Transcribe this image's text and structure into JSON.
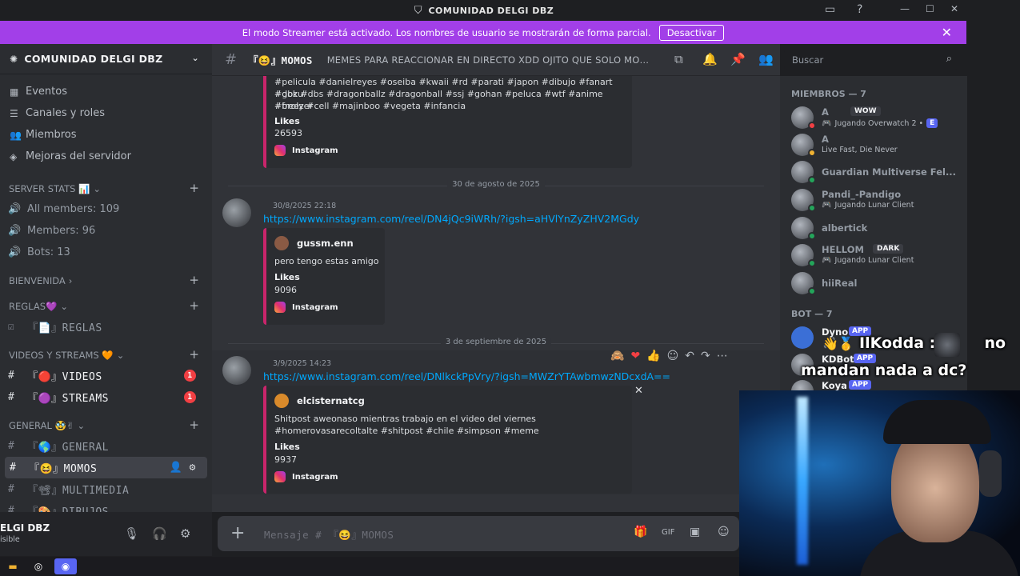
{
  "titlebar": {
    "title": "COMUNIDAD DELGI DBZ"
  },
  "banner": {
    "message": "El modo Streamer está activado. Los nombres de usuario se mostrarán de forma parcial.",
    "button": "Desactivar"
  },
  "server": {
    "name": "COMUNIDAD DELGI DBZ",
    "menu": [
      "Eventos",
      "Canales y roles",
      "Miembros",
      "Mejoras del servidor"
    ],
    "categories": {
      "stats": "SERVER STATS 📊",
      "bienvenida": "BIENVENIDA",
      "reglas": "REGLAS💜",
      "videos": "VIDEOS Y STREAMS 🧡",
      "general": "GENERAL 🥸✌"
    },
    "stats_channels": [
      "All members: 109",
      "Members: 96",
      "Bots: 13"
    ],
    "channels": {
      "reglas": "『📄』REGLAS",
      "videos": "『🔴』VIDEOS",
      "streams": "『🟣』STREAMS",
      "general": "『🌎』GENERAL",
      "momos": "『😆』MOMOS",
      "multimedia": "『📽』MULTIMEDIA",
      "dibujos": "『🎨』DIBUJOS"
    },
    "badges": {
      "videos": "1",
      "streams": "1"
    }
  },
  "user": {
    "name": "ELGI DBZ",
    "status": "isible"
  },
  "channel_header": {
    "name": "『😆』MOMOS",
    "topic": "MEMES PARA REACCIONAR EN DIRECTO XDD OJITO QUE SOLO MOMAZOS"
  },
  "search": {
    "placeholder": "Buscar"
  },
  "messages": {
    "m1": {
      "text_lines": [
        "#pelicula #danielreyes #oseiba #kwaii #rd #parati #japon #dibujo #fanart #goku",
        "#dbz #dbs #dragonballz #dragonball #ssj #gohan #peluca #wtf #anime #freezer",
        "#broly #cell #majinboo #vegeta #infancia"
      ],
      "likes_label": "Likes",
      "likes": "26593",
      "provider": "Instagram"
    },
    "date2": "30 de agosto de 2025",
    "m2": {
      "timestamp": "30/8/2025 22:18",
      "link": "https://www.instagram.com/reel/DN4jQc9iWRh/?igsh=aHVlYnZyZHV2MGdy",
      "author": "gussm.enn",
      "text": "pero tengo estas amigo",
      "likes_label": "Likes",
      "likes": "9096",
      "provider": "Instagram"
    },
    "date3": "3 de septiembre de 2025",
    "m3": {
      "timestamp": "3/9/2025 14:23",
      "link": "https://www.instagram.com/reel/DNlkckPpVry/?igsh=MWZrYTAwbmwzNDcxdA==",
      "author": "elcisternatcg",
      "text_lines": [
        "Shitpost aweonaso mientras trabajo en el video del viernes",
        "#homerovasarecoltalte #shitpost #chile #simpson #meme"
      ],
      "likes_label": "Likes",
      "likes": "9937",
      "provider": "Instagram"
    }
  },
  "composer": {
    "placeholder": "Mensaje # 『😆』MOMOS"
  },
  "members": {
    "header": "MIEMBROS — 7",
    "list": [
      {
        "name": "A",
        "tag": "WOW",
        "activity": "Jugando Overwatch 2 •"
      },
      {
        "name": "A",
        "tag": "",
        "activity": "Live Fast, Die Never"
      },
      {
        "name": "Guardian Multiverse Fel...",
        "tag": "",
        "activity": ""
      },
      {
        "name": "Pandi_-Pandigo",
        "tag": "",
        "activity": "Jugando Lunar Client"
      },
      {
        "name": "albertick",
        "tag": "",
        "activity": ""
      },
      {
        "name": "HELLOM",
        "tag": "DARK",
        "activity": "Jugando Lunar Client"
      },
      {
        "name": "hiiReal",
        "tag": "",
        "activity": ""
      }
    ],
    "bot_header": "BOT — 7",
    "bots": [
      {
        "name": "Dyno",
        "tag": "APP"
      },
      {
        "name": "KDBot",
        "tag": "APP"
      },
      {
        "name": "Koya",
        "tag": "APP"
      }
    ]
  },
  "overlay": {
    "username": "IlKodda :",
    "message_part1": "no",
    "message_part2": "mandan nada a dc?"
  }
}
